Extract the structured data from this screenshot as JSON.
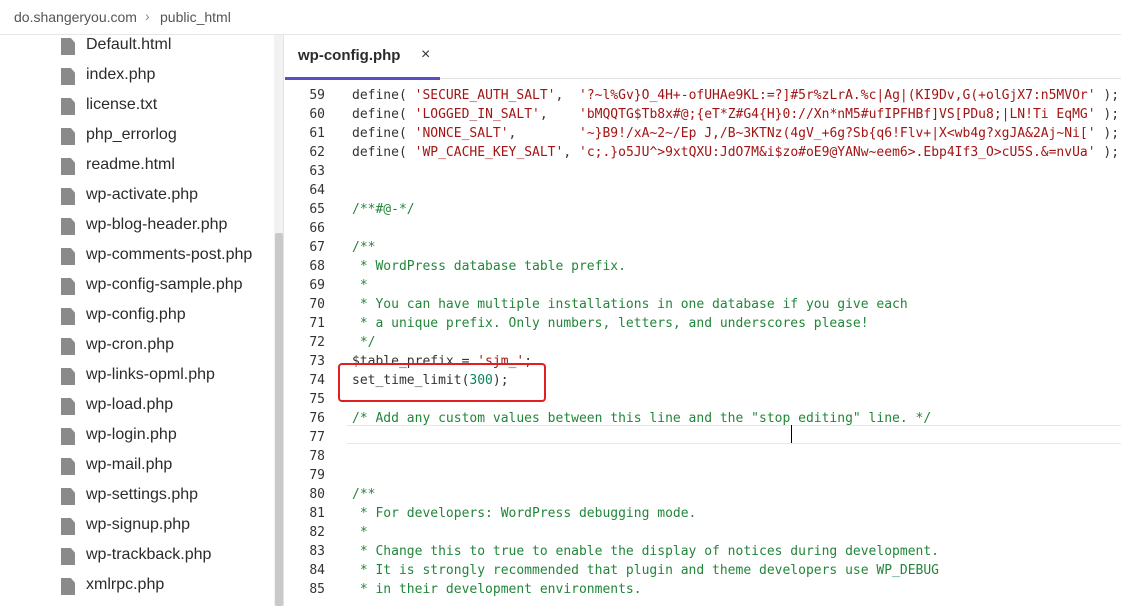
{
  "breadcrumb": {
    "domain": "do.shangeryou.com",
    "separator": "›",
    "folder": "public_html"
  },
  "sidebar": {
    "files": [
      {
        "name": "Default.html"
      },
      {
        "name": "index.php"
      },
      {
        "name": "license.txt"
      },
      {
        "name": "php_errorlog"
      },
      {
        "name": "readme.html"
      },
      {
        "name": "wp-activate.php"
      },
      {
        "name": "wp-blog-header.php"
      },
      {
        "name": "wp-comments-post.php"
      },
      {
        "name": "wp-config-sample.php"
      },
      {
        "name": "wp-config.php"
      },
      {
        "name": "wp-cron.php"
      },
      {
        "name": "wp-links-opml.php"
      },
      {
        "name": "wp-load.php"
      },
      {
        "name": "wp-login.php"
      },
      {
        "name": "wp-mail.php"
      },
      {
        "name": "wp-settings.php"
      },
      {
        "name": "wp-signup.php"
      },
      {
        "name": "wp-trackback.php"
      },
      {
        "name": "xmlrpc.php"
      }
    ]
  },
  "editor": {
    "tab": {
      "label": "wp-config.php",
      "close": "×"
    },
    "lines": [
      {
        "n": "59",
        "text": "define( 'SECURE_AUTH_SALT',  '?~l%Gv}O_4H+-ofUHAe9KL:=?]#5r%zLrA.%c|Ag|(KI9Dv,G(+olGjX7:n5MVOr' );"
      },
      {
        "n": "60",
        "text": "define( 'LOGGED_IN_SALT',    'bMQQTG$Tb8x#@;{eT*Z#G4{H}0://Xn*nM5#ufIPFHBf]VS[PDu8;|LN!Ti EqMG' );"
      },
      {
        "n": "61",
        "text": "define( 'NONCE_SALT',        '~}B9!/xA~2~/Ep J,/B~3KTNz(4gV_+6g?Sb{q6!Flv+|X<wb4g?xgJA&2Aj~Ni[' );"
      },
      {
        "n": "62",
        "text": "define( 'WP_CACHE_KEY_SALT', 'c;.}o5JU^>9xtQXU:JdO7M&i$zo#oE9@YANw~eem6>.Ebp4If3_O>cU5S.&=nvUa' );"
      },
      {
        "n": "63",
        "text": ""
      },
      {
        "n": "64",
        "text": ""
      },
      {
        "n": "65",
        "text": "/**#@-*/"
      },
      {
        "n": "66",
        "text": ""
      },
      {
        "n": "67",
        "text": "/**"
      },
      {
        "n": "68",
        "text": " * WordPress database table prefix."
      },
      {
        "n": "69",
        "text": " *"
      },
      {
        "n": "70",
        "text": " * You can have multiple installations in one database if you give each"
      },
      {
        "n": "71",
        "text": " * a unique prefix. Only numbers, letters, and underscores please!"
      },
      {
        "n": "72",
        "text": " */"
      },
      {
        "n": "73",
        "text": "$table_prefix = 'sjm_';"
      },
      {
        "n": "74",
        "text": "set_time_limit(300);"
      },
      {
        "n": "75",
        "text": ""
      },
      {
        "n": "76",
        "text": "/* Add any custom values between this line and the \"stop editing\" line. */"
      },
      {
        "n": "77",
        "text": ""
      },
      {
        "n": "78",
        "text": ""
      },
      {
        "n": "79",
        "text": ""
      },
      {
        "n": "80",
        "text": "/**"
      },
      {
        "n": "81",
        "text": " * For developers: WordPress debugging mode."
      },
      {
        "n": "82",
        "text": " *"
      },
      {
        "n": "83",
        "text": " * Change this to true to enable the display of notices during development."
      },
      {
        "n": "84",
        "text": " * It is strongly recommended that plugin and theme developers use WP_DEBUG"
      },
      {
        "n": "85",
        "text": " * in their development environments."
      }
    ]
  },
  "colors": {
    "accent": "#5b4fc7",
    "highlight_border": "#e02020",
    "comment": "#22863a",
    "string": "#a31515",
    "number": "#098658"
  }
}
